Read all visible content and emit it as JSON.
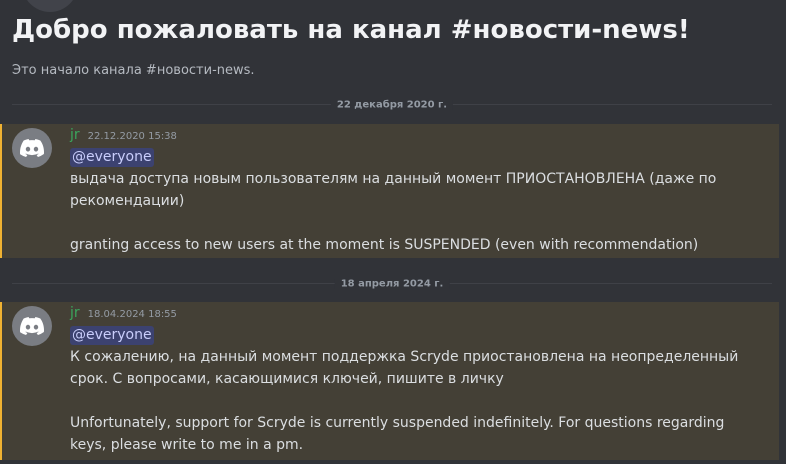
{
  "channel_intro": {
    "title": "Добро пожаловать на канал #новости-news!",
    "subtitle": "Это начало канала #новости-news."
  },
  "date_dividers": [
    "22 декабря 2020 г.",
    "18 апреля 2024 г."
  ],
  "messages": [
    {
      "author": "jr",
      "timestamp": "22.12.2020 15:38",
      "mention": "@everyone",
      "lines": [
        "выдача доступа новым пользователям на данный момент ПРИОСТАНОВЛЕНА (даже по",
        "рекомендации)",
        "",
        "granting access to new users at the moment is SUSPENDED (even with recommendation)"
      ]
    },
    {
      "author": "jr",
      "timestamp": "18.04.2024 18:55",
      "mention": "@everyone",
      "lines": [
        "К сожалению, на данный момент поддержка Scryde приостановлена на неопределенный",
        "срок. С вопросами, касающимися ключей, пишите в личку",
        "",
        "Unfortunately, support for Scryde is currently suspended indefinitely. For questions regarding",
        "keys, please write to me in a pm."
      ]
    }
  ],
  "icons": {
    "avatar": "discord-logo-icon"
  },
  "colors": {
    "background": "#313338",
    "highlight": "#444036",
    "highlight_bar": "#f0b232",
    "author": "#3ba55d",
    "mention_bg": "#3c4270"
  }
}
